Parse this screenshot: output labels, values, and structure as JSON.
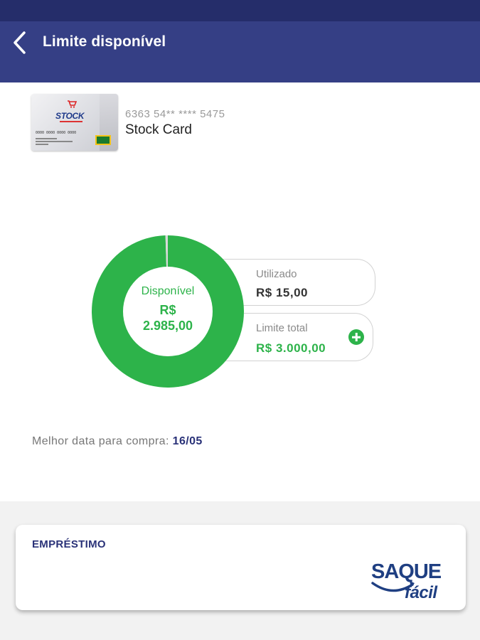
{
  "app_bar": {
    "title": "Limite disponível",
    "back_icon": "chevron-left-icon"
  },
  "card": {
    "number": "6363 54** **** 5475",
    "name": "Stock Card",
    "image": {
      "brand": "STOCK",
      "printed_number": "0000 0000 0000 0000"
    }
  },
  "limit": {
    "available_label": "Disponível",
    "available_currency": "R$",
    "available_amount": "2.985,00",
    "used_label": "Utilizado",
    "used_value": "R$ 15,00",
    "total_label": "Limite total",
    "total_value": "R$ 3.000,00",
    "used_fraction": 0.005,
    "available_color": "#2db34a",
    "used_color": "#d9d9d9",
    "add_icon": "plus-circle-icon"
  },
  "best_date": {
    "label": "Melhor data para compra:",
    "value": "16/05"
  },
  "loan": {
    "title": "EMPRÉSTIMO",
    "logo_top": "SAQUE",
    "logo_bottom": "fácil"
  },
  "colors": {
    "status_bar": "#252d6a",
    "app_bar": "#353f85",
    "accent_green": "#2db34a",
    "navy_text": "#2a3278"
  }
}
